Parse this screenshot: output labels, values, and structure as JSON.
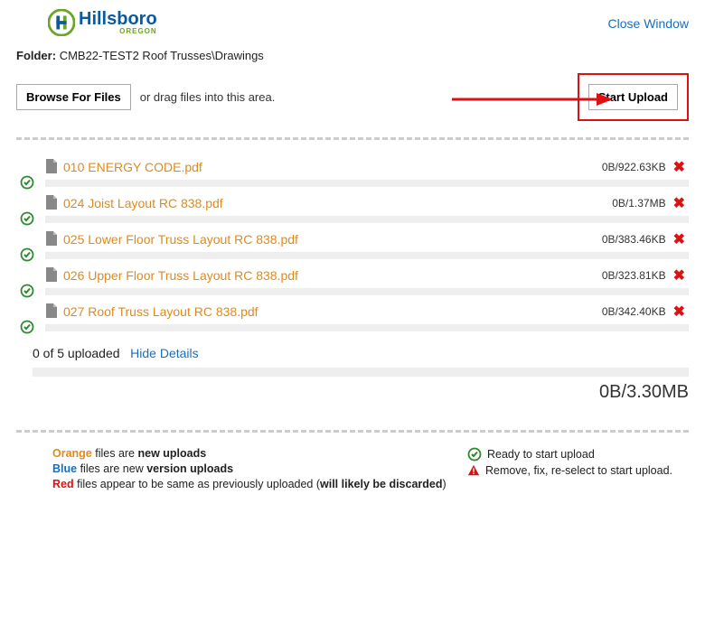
{
  "brand": {
    "name": "Hillsboro",
    "sub": "OREGON"
  },
  "close_label": "Close Window",
  "folder": {
    "label": "Folder:",
    "path": "CMB22-TEST2 Roof Trusses\\Drawings"
  },
  "toolbar": {
    "browse_label": "Browse For Files",
    "drag_text": "or drag files into this area.",
    "start_label": "Start Upload"
  },
  "files": [
    {
      "name": "010 ENERGY CODE.pdf",
      "size": "0B/922.63KB"
    },
    {
      "name": "024 Joist Layout RC 838.pdf",
      "size": "0B/1.37MB"
    },
    {
      "name": "025 Lower Floor Truss Layout RC 838.pdf",
      "size": "0B/383.46KB"
    },
    {
      "name": "026 Upper Floor Truss Layout RC 838.pdf",
      "size": "0B/323.81KB"
    },
    {
      "name": "027 Roof Truss Layout RC 838.pdf",
      "size": "0B/342.40KB"
    }
  ],
  "summary": {
    "uploaded_text": "0 of 5 uploaded",
    "hide_details": "Hide Details",
    "total_size": "0B/3.30MB"
  },
  "legend": {
    "orange_prefix": "Orange",
    "orange_rest": " files are ",
    "orange_bold": "new uploads",
    "blue_prefix": "Blue",
    "blue_rest": " files are new ",
    "blue_bold": "version uploads",
    "red_prefix": "Red",
    "red_rest": " files appear to be same as previously uploaded (",
    "red_bold": "will likely be discarded",
    "red_close": ")",
    "ready": "Ready to start upload",
    "remove": "Remove, fix, re-select to start upload."
  }
}
